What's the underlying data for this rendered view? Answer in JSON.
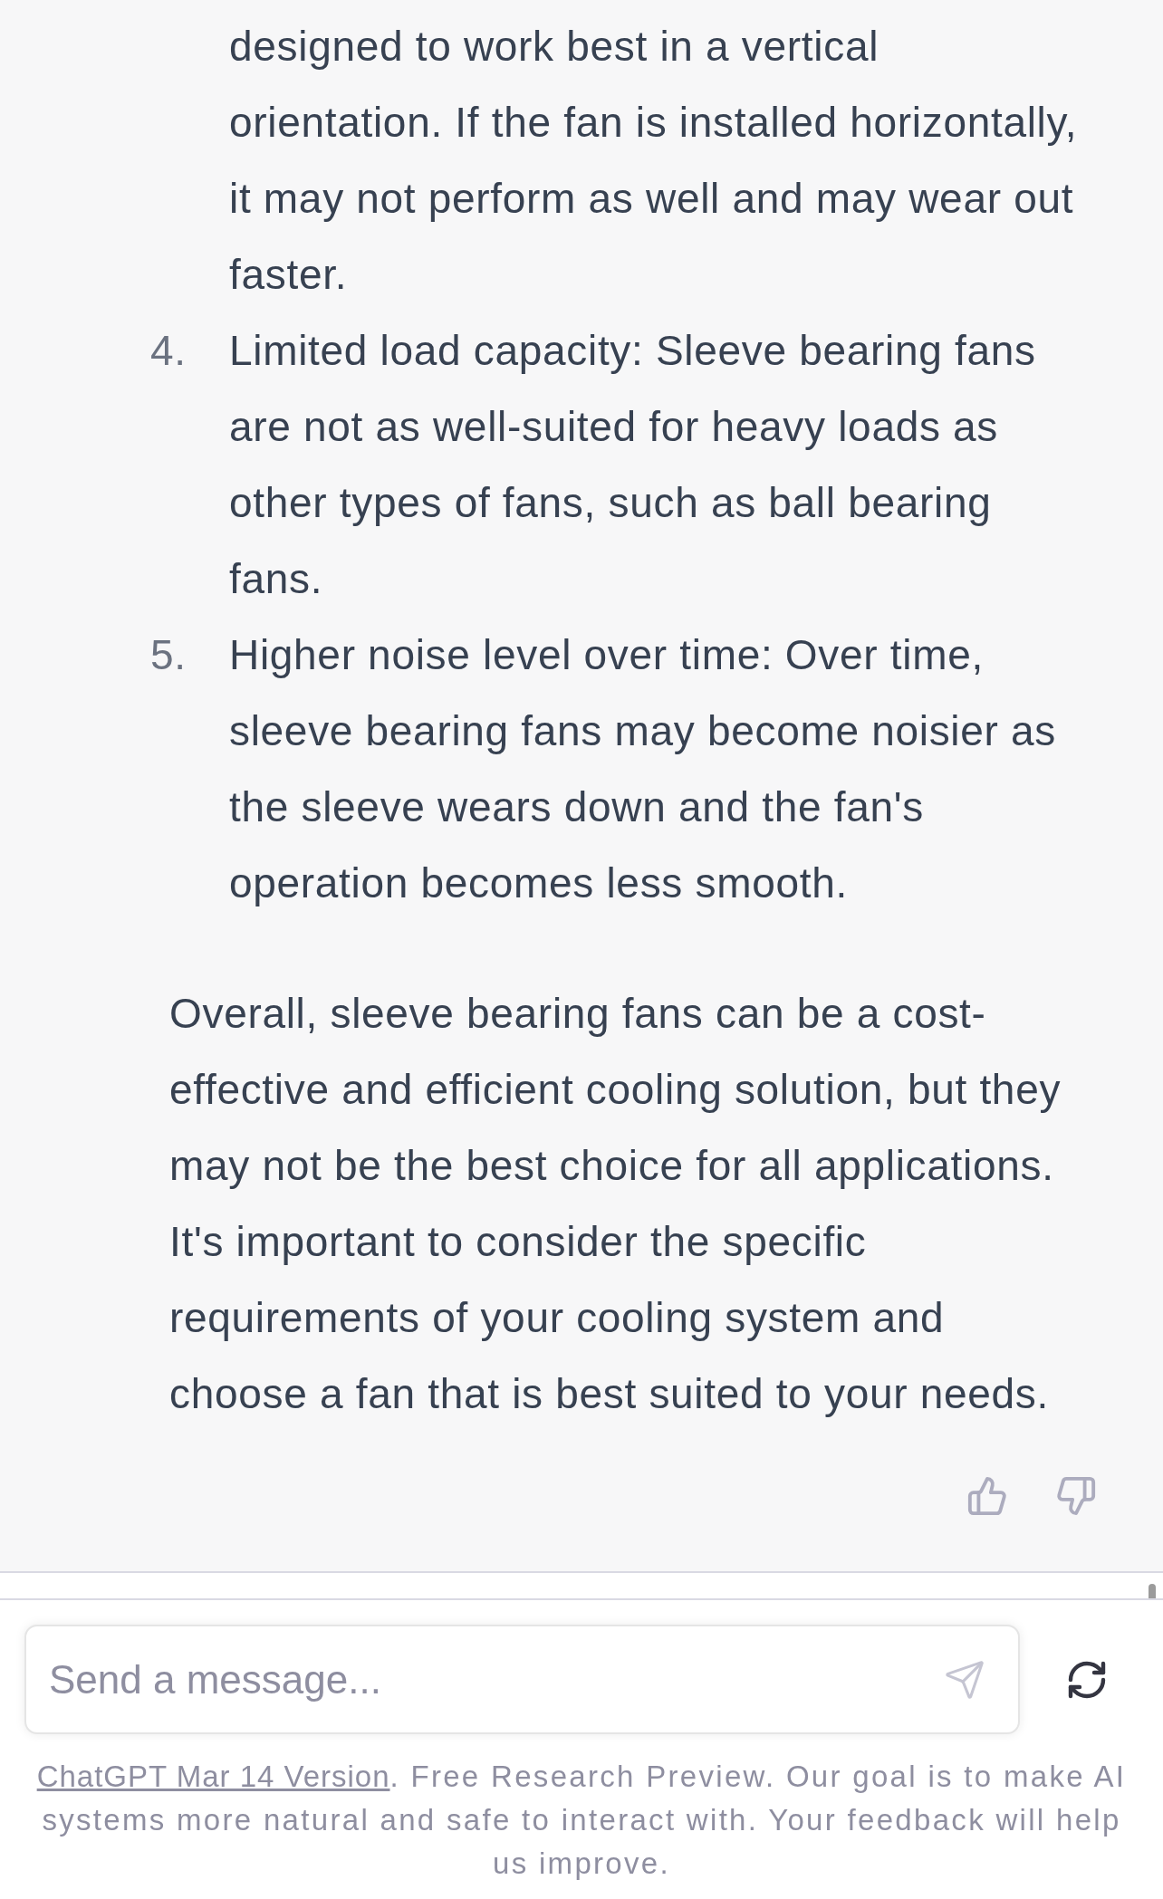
{
  "message": {
    "list_continuation": "designed to work best in a vertical orientation. If the fan is installed horizontally, it may not perform as well and may wear out faster.",
    "list_items": [
      {
        "number": "4.",
        "text": "Limited load capacity: Sleeve bearing fans are not as well-suited for heavy loads as other types of fans, such as ball bearing fans."
      },
      {
        "number": "5.",
        "text": "Higher noise level over time: Over time, sleeve bearing fans may become noisier as the sleeve wears down and the fan's operation becomes less smooth."
      }
    ],
    "paragraph": "Overall, sleeve bearing fans can be a cost-effective and efficient cooling solution, but they may not be the best choice for all applications. It's important to consider the specific requirements of your cooling system and choose a fan that is best suited to your needs."
  },
  "composer": {
    "placeholder": "Send a message..."
  },
  "footer": {
    "link": "ChatGPT Mar 14 Version",
    "text": ". Free Research Preview. Our goal is to make AI systems more natural and safe to interact with. Your feedback will help us improve."
  }
}
